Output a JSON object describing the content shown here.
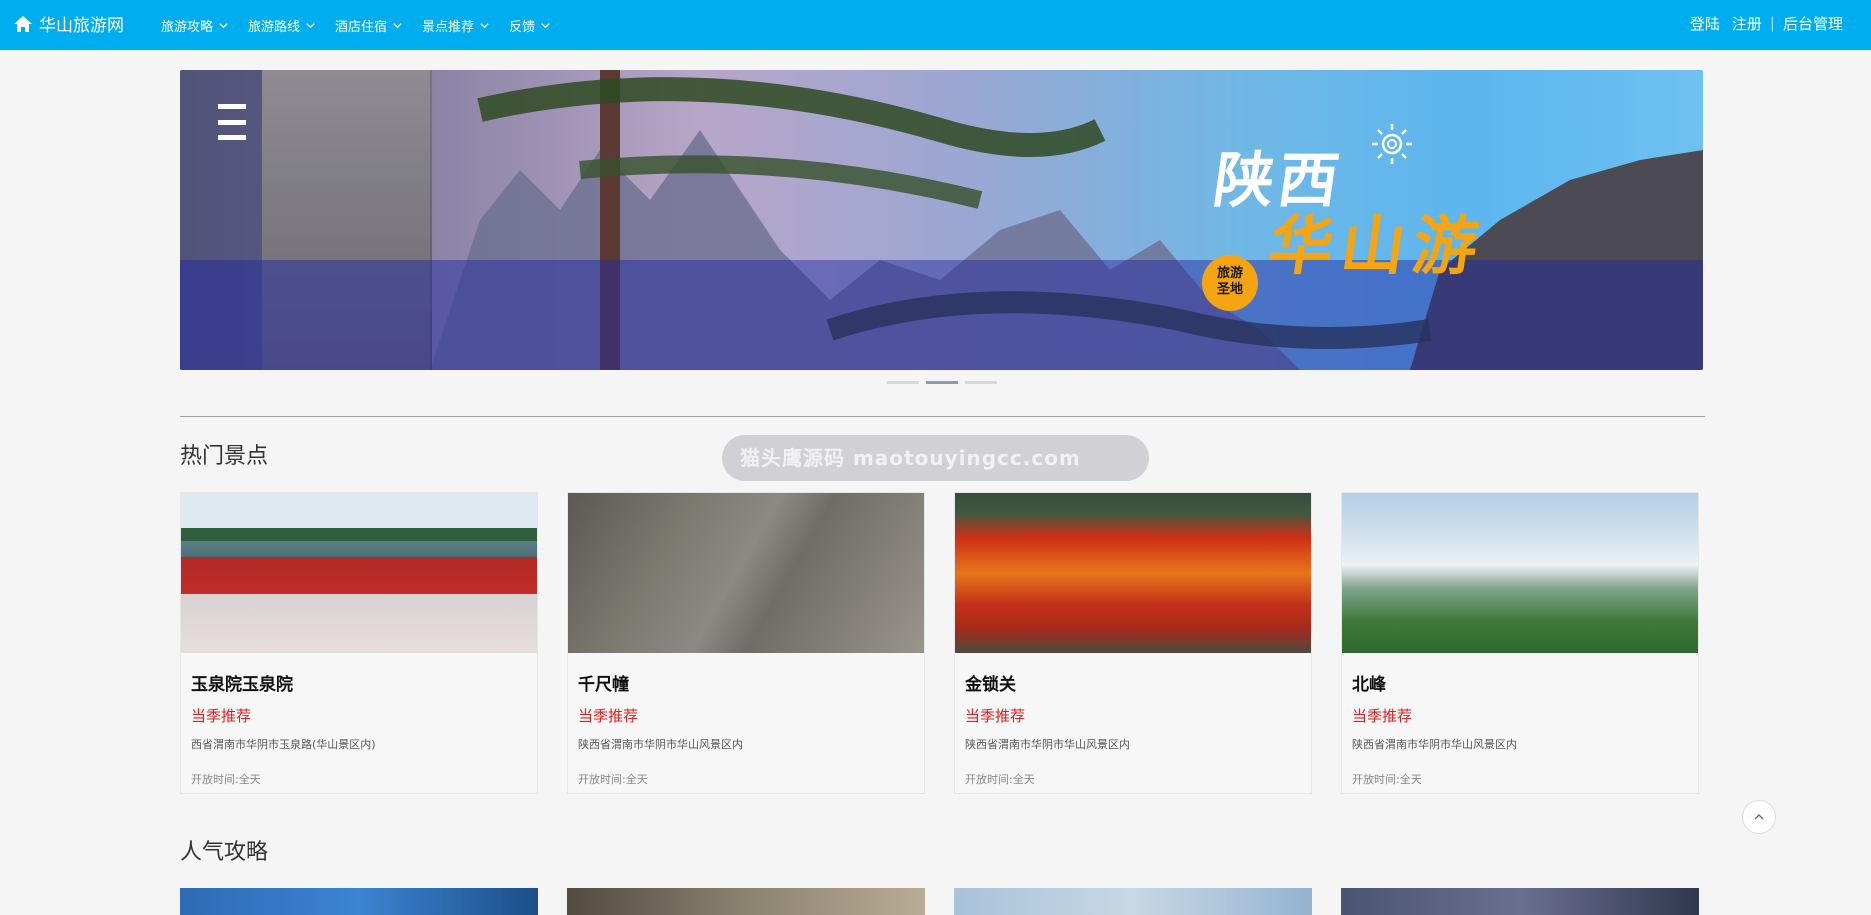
{
  "nav": {
    "brand": "华山旅游网",
    "menu": [
      {
        "label": "旅游攻略"
      },
      {
        "label": "旅游路线"
      },
      {
        "label": "酒店住宿"
      },
      {
        "label": "景点推荐"
      },
      {
        "label": "反馈"
      }
    ],
    "login": "登陆",
    "register": "注册",
    "separator": "|",
    "admin": "后台管理"
  },
  "banner": {
    "title_line1": "陕西",
    "title_line2": "华山游",
    "badge_line1": "旅游",
    "badge_line2": "圣地",
    "slide_count": 3,
    "active_slide": 2
  },
  "watermark": "猫头鹰源码 maotouyingcc.com",
  "hot_spots": {
    "title": "热门景点",
    "items": [
      {
        "name": "玉泉院玉泉院",
        "tag": "当季推荐",
        "address": "西省渭南市华阴市玉泉路(华山景区内)",
        "hours": "开放时间:全天"
      },
      {
        "name": "千尺幢",
        "tag": "当季推荐",
        "address": "陕西省渭南市华阴市华山风景区内",
        "hours": "开放时间:全天"
      },
      {
        "name": "金锁关",
        "tag": "当季推荐",
        "address": "陕西省渭南市华阴市华山风景区内",
        "hours": "开放时间:全天"
      },
      {
        "name": "北峰",
        "tag": "当季推荐",
        "address": "陕西省渭南市华阴市华山风景区内",
        "hours": "开放时间:全天"
      }
    ]
  },
  "popular_guides": {
    "title": "人气攻略"
  },
  "colors": {
    "nav_bg": "#00aeef",
    "accent_red": "#e0201e",
    "banner_orange": "#f5a512"
  }
}
